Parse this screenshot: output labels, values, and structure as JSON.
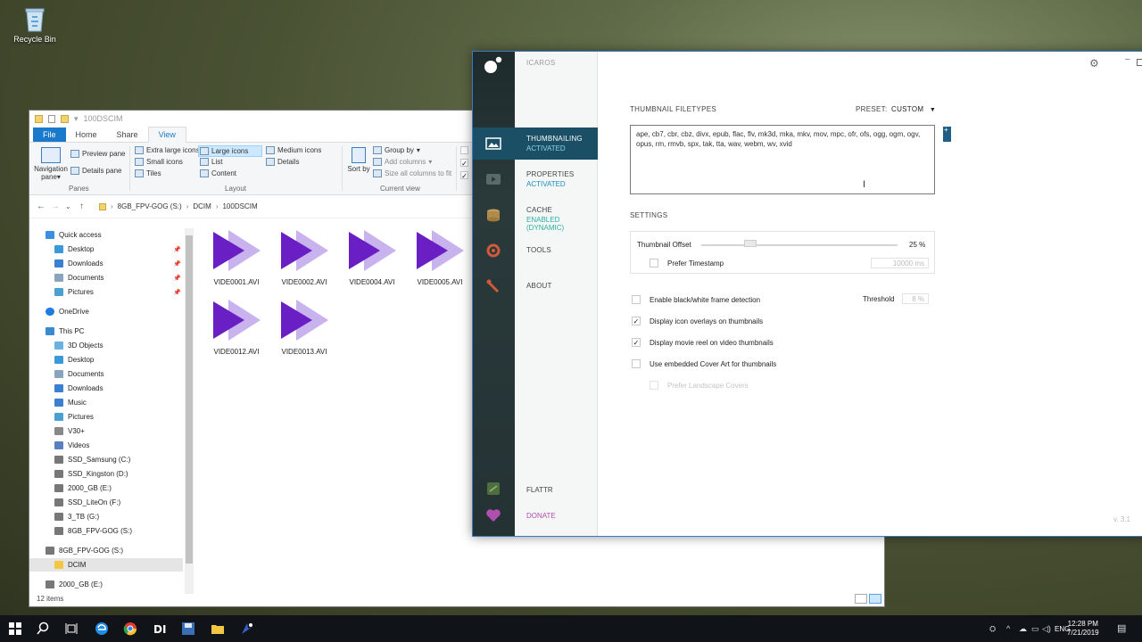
{
  "desktop": {
    "recycle_bin_label": "Recycle Bin"
  },
  "explorer": {
    "title": "100DSCIM",
    "tabs": [
      "File",
      "Home",
      "Share",
      "View"
    ],
    "active_tab": "View",
    "ribbon": {
      "panes": {
        "navigation_pane": "Navigation pane",
        "preview_pane": "Preview pane",
        "details_pane": "Details pane",
        "label": "Panes"
      },
      "layout": {
        "items": [
          "Extra large icons",
          "Large icons",
          "Medium icons",
          "Small icons",
          "List",
          "Details",
          "Tiles",
          "Content"
        ],
        "selected": "Large icons",
        "label": "Layout"
      },
      "current_view": {
        "sort_by": "Sort by",
        "group_by": "Group by",
        "add_columns": "Add columns",
        "size_columns": "Size all columns to fit",
        "label": "Current view"
      }
    },
    "address": {
      "crumbs": [
        "8GB_FPV-GOG (S:)",
        "DCIM",
        "100DSCIM"
      ]
    },
    "nav": [
      {
        "label": "Quick access",
        "level": 0,
        "kind": "star"
      },
      {
        "label": "Desktop",
        "level": 1,
        "kind": "desk",
        "pinned": true
      },
      {
        "label": "Downloads",
        "level": 1,
        "kind": "down",
        "pinned": true
      },
      {
        "label": "Documents",
        "level": 1,
        "kind": "doc",
        "pinned": true
      },
      {
        "label": "Pictures",
        "level": 1,
        "kind": "pic",
        "pinned": true
      },
      {
        "label": "OneDrive",
        "level": 0,
        "kind": "cloud"
      },
      {
        "label": "This PC",
        "level": 0,
        "kind": "pc"
      },
      {
        "label": "3D Objects",
        "level": 1,
        "kind": "obj"
      },
      {
        "label": "Desktop",
        "level": 1,
        "kind": "desk"
      },
      {
        "label": "Documents",
        "level": 1,
        "kind": "doc"
      },
      {
        "label": "Downloads",
        "level": 1,
        "kind": "down"
      },
      {
        "label": "Music",
        "level": 1,
        "kind": "music"
      },
      {
        "label": "Pictures",
        "level": 1,
        "kind": "pic"
      },
      {
        "label": "V30+",
        "level": 1,
        "kind": "phone"
      },
      {
        "label": "Videos",
        "level": 1,
        "kind": "vid"
      },
      {
        "label": "SSD_Samsung (C:)",
        "level": 1,
        "kind": "drive"
      },
      {
        "label": "SSD_Kingston (D:)",
        "level": 1,
        "kind": "drive"
      },
      {
        "label": "2000_GB (E:)",
        "level": 1,
        "kind": "drive"
      },
      {
        "label": "SSD_LiteOn (F:)",
        "level": 1,
        "kind": "drive"
      },
      {
        "label": "3_TB (G:)",
        "level": 1,
        "kind": "drive"
      },
      {
        "label": "8GB_FPV-GOG (S:)",
        "level": 1,
        "kind": "drive"
      },
      {
        "label": "8GB_FPV-GOG (S:)",
        "level": 0,
        "kind": "drive"
      },
      {
        "label": "DCIM",
        "level": 1,
        "kind": "folder",
        "selected": true
      },
      {
        "label": "2000_GB (E:)",
        "level": 0,
        "kind": "drive"
      }
    ],
    "files": [
      "VIDE0001.AVI",
      "VIDE0002.AVI",
      "VIDE0004.AVI",
      "VIDE0005.AVI",
      "VIDE0012.AVI",
      "VIDE0013.AVI"
    ],
    "status": "12 items"
  },
  "icaros": {
    "title": "ICAROS",
    "version": "v. 3.1",
    "nav": [
      {
        "label": "THUMBNAILING",
        "status": "ACTIVATED",
        "active": true
      },
      {
        "label": "PROPERTIES",
        "status": "ACTIVATED"
      },
      {
        "label": "CACHE",
        "status": "ENABLED (DYNAMIC)"
      },
      {
        "label": "TOOLS",
        "status": ""
      },
      {
        "label": "ABOUT",
        "status": ""
      }
    ],
    "flattr": "FLATTR",
    "donate": "DONATE",
    "thumbnail_filetypes_heading": "THUMBNAIL FILETYPES",
    "preset_label": "PRESET:",
    "preset_value": "CUSTOM",
    "filetypes": "ape,  cb7,  cbr,  cbz,  divx,  epub,  flac,  flv,  mk3d,  mka,  mkv,  mov,  mpc,  ofr,  ofs,  ogg,  ogm,  ogv,  opus,  rm,  rmvb,  spx,  tak,  tta,  wav,  webm,  wv,  xvid",
    "settings_heading": "SETTINGS",
    "thumbnail_offset_label": "Thumbnail Offset",
    "thumbnail_offset_value": "25 %",
    "thumbnail_offset_fraction": 0.25,
    "prefer_timestamp_label": "Prefer Timestamp",
    "timestamp_value": "10000 ms",
    "options": [
      {
        "label": "Enable black/white frame detection",
        "checked": false
      },
      {
        "label": "Display icon overlays on thumbnails",
        "checked": true
      },
      {
        "label": "Display movie reel on video thumbnails",
        "checked": true
      },
      {
        "label": "Use embedded Cover Art for thumbnails",
        "checked": false
      }
    ],
    "threshold_label": "Threshold",
    "threshold_value": "8 %",
    "prefer_landscape_label": "Prefer Landscape Covers"
  },
  "taskbar": {
    "time": "12:28 PM",
    "date": "7/21/2019",
    "lang": "ENG"
  },
  "colors": {
    "explorer_accent": "#1979ca",
    "icaros_active": "#1a4f66",
    "icaros_status": "#1a8ec0",
    "cache_status": "#2ab0a0",
    "donate": "#b04fb0",
    "video_purple": "#6a1fc4"
  }
}
